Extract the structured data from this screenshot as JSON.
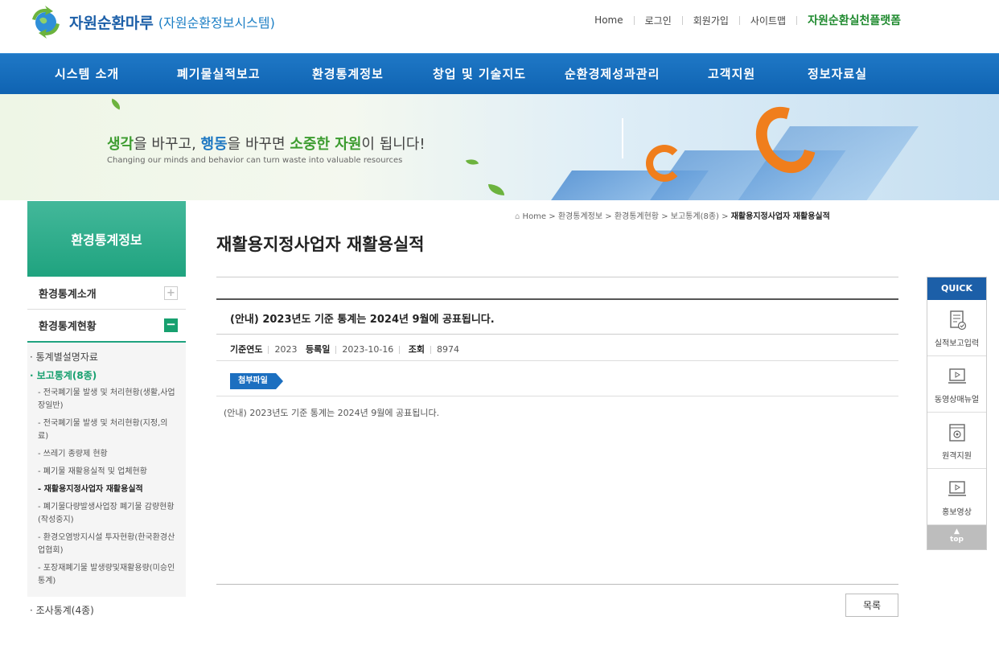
{
  "header": {
    "logo_title": "자원순환마루",
    "logo_subtitle": "(자원순환정보시스템)",
    "util_links": [
      "Home",
      "로그인",
      "회원가입",
      "사이트맵"
    ],
    "platform_link": "자원순환실천플랫폼"
  },
  "gnb": [
    "시스템 소개",
    "폐기물실적보고",
    "환경통계정보",
    "창업 및 기술지도",
    "순환경제성과관리",
    "고객지원",
    "정보자료실"
  ],
  "banner": {
    "msg_1": "생각",
    "msg_2": "을 바꾸고, ",
    "msg_3": "행동",
    "msg_4": "을 바꾸면 ",
    "msg_5": "소중한 자원",
    "msg_6": "이 됩니다!",
    "sub": "Changing our minds and behavior can turn waste into valuable resources"
  },
  "lnb": {
    "title": "환경통계정보",
    "menu_1": "환경통계소개",
    "menu_2": "환경통계현황",
    "plus": "+",
    "minus": "−",
    "d2_1": "통계별설명자료",
    "d2_2": "보고통계(8종)",
    "d3": [
      "전국폐기물 발생 및 처리현황(생활,사업장일반)",
      "전국폐기물 발생 및 처리현황(지정,의료)",
      "쓰레기 종량제 현황",
      "폐기물 재활용실적 및 업체현황",
      "재활용지정사업자 재활용실적",
      "폐기물다량발생사업장 폐기물 감량현황(작성중지)",
      "환경오염방지시설 투자현황(한국환경산업협회)",
      "포장재폐기물 발생량및재활용량(미승인통계)"
    ],
    "d2_3": "조사통계(4종)"
  },
  "breadcrumb": {
    "home": "Home",
    "c1": "환경통계정보",
    "c2": "환경통계현황",
    "c3": "보고통계(8종)",
    "current": "재활용지정사업자 재활용실적",
    "sep": ">"
  },
  "page_title": "재활용지정사업자 재활용실적",
  "board": {
    "title": "(안내) 2023년도 기준 통계는 2024년 9월에 공표됩니다.",
    "year_label": "기준연도",
    "year_value": "2023",
    "date_label": "등록일",
    "date_value": "2023-10-16",
    "views_label": "조회",
    "views_value": "8974",
    "attach_label": "첨부파일",
    "body": "(안내) 2023년도 기준 통계는 2024년 9월에 공표됩니다.",
    "list_button": "목록"
  },
  "quick": {
    "title": "QUICK",
    "items": [
      "실적보고입력",
      "동영상매뉴얼",
      "원격지원",
      "홍보영상"
    ],
    "top_arrow": "▲",
    "top": "top"
  },
  "colors": {
    "brand_blue": "#1c6fc0",
    "green": "#17a06f",
    "platform_green": "#1f8a2f"
  }
}
